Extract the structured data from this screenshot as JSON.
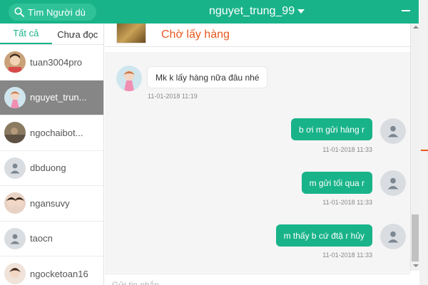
{
  "header": {
    "search_placeholder": "Tìm Người dù",
    "chat_title": "nguyet_trung_99",
    "accent_color": "#19b38a"
  },
  "sidebar": {
    "tabs": [
      {
        "label": "Tất cả",
        "active": true
      },
      {
        "label": "Chưa đọc",
        "active": false
      }
    ],
    "contacts": [
      {
        "name": "tuan3004pro",
        "avatar": "photo"
      },
      {
        "name": "nguyet_trun...",
        "avatar": "photo",
        "active": true
      },
      {
        "name": "ngochaibot...",
        "avatar": "photo"
      },
      {
        "name": "dbduong",
        "avatar": "default-user-icon"
      },
      {
        "name": "ngansuvy",
        "avatar": "photo"
      },
      {
        "name": "taocn",
        "avatar": "default-user-icon"
      },
      {
        "name": "ngocketoan16",
        "avatar": "photo"
      }
    ]
  },
  "order": {
    "status": "Chờ lấy hàng",
    "status_color": "#e8571e"
  },
  "messages": [
    {
      "direction": "in",
      "text": "Mk k lấy hàng nữa đâu nhé",
      "time": "11-01-2018 11:19"
    },
    {
      "direction": "out",
      "text": "b ơi m gửi hàng r",
      "time": "11-01-2018 11:33"
    },
    {
      "direction": "out",
      "text": "m gửi tối qua r",
      "time": "11-01-2018 11:33"
    },
    {
      "direction": "out",
      "text": "m thấy b cứ đtặ r hủy",
      "time": "11-01-2018 11:33"
    }
  ],
  "composer": {
    "placeholder": "Gửi tin nhắn..."
  }
}
